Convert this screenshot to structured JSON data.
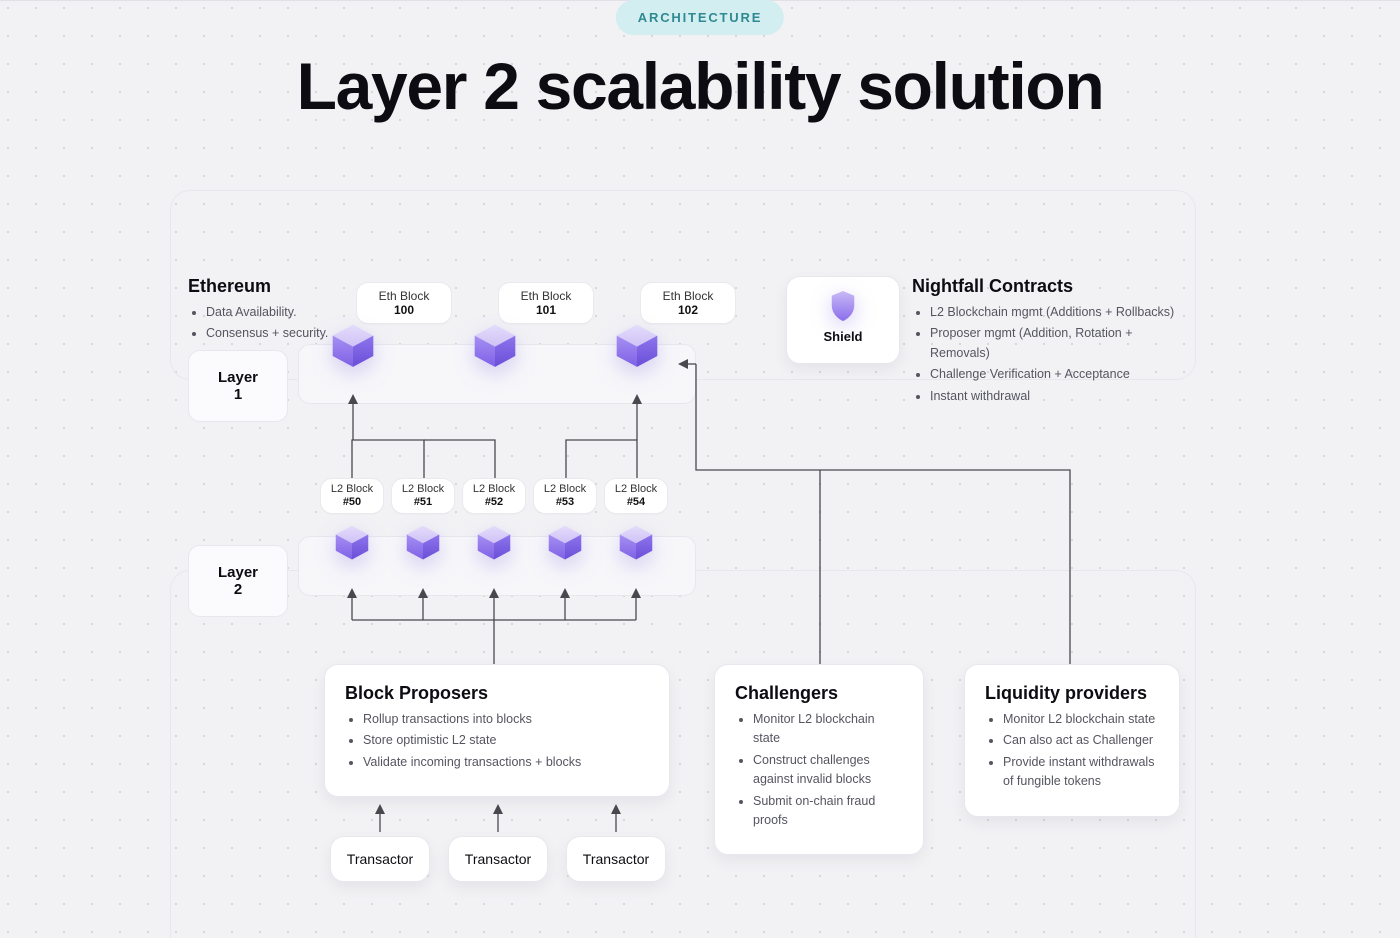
{
  "badge": "ARCHITECTURE",
  "title": "Layer 2 scalability solution",
  "ethereum": {
    "heading": "Ethereum",
    "bullets": [
      "Data Availability.",
      "Consensus + security."
    ]
  },
  "layer_labels": {
    "l1": "Layer 1",
    "l2": "Layer 2"
  },
  "eth_blocks": [
    {
      "prefix": "Eth Block",
      "num": "100"
    },
    {
      "prefix": "Eth Block",
      "num": "101"
    },
    {
      "prefix": "Eth Block",
      "num": "102"
    }
  ],
  "l2_blocks": [
    {
      "prefix": "L2 Block",
      "num": "#50"
    },
    {
      "prefix": "L2 Block",
      "num": "#51"
    },
    {
      "prefix": "L2 Block",
      "num": "#52"
    },
    {
      "prefix": "L2 Block",
      "num": "#53"
    },
    {
      "prefix": "L2 Block",
      "num": "#54"
    }
  ],
  "shield": {
    "label": "Shield"
  },
  "nightfall": {
    "heading": "Nightfall Contracts",
    "bullets": [
      "L2 Blockchain mgmt (Additions + Rollbacks)",
      "Proposer mgmt (Addition, Rotation + Removals)",
      "Challenge Verification + Acceptance",
      "Instant withdrawal"
    ]
  },
  "block_proposers": {
    "heading": "Block Proposers",
    "bullets": [
      "Rollup transactions into blocks",
      "Store optimistic L2 state",
      "Validate incoming transactions + blocks"
    ]
  },
  "challengers": {
    "heading": "Challengers",
    "bullets": [
      "Monitor L2 blockchain state",
      "Construct challenges against invalid blocks",
      "Submit on-chain fraud proofs"
    ]
  },
  "liquidity": {
    "heading": "Liquidity providers",
    "bullets": [
      "Monitor L2 blockchain state",
      "Can also act as Challenger",
      "Provide instant withdrawals of fungible tokens"
    ]
  },
  "transactor_label": "Transactor"
}
